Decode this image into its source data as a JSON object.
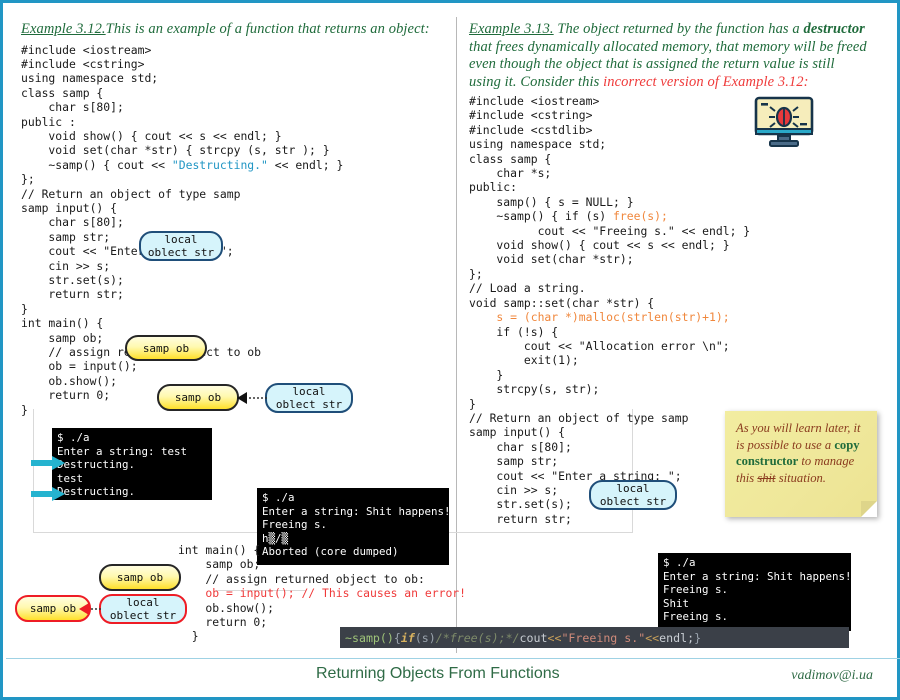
{
  "slide": {
    "accent_border": "#2196c4",
    "footer_title": "Returning Objects From Functions",
    "footer_email": "vadimov@i.ua"
  },
  "left": {
    "heading_label": "Example 3.12.",
    "heading_text": "This  is an example of a function that returns an object:",
    "code": [
      "#include <iostream>",
      "#include <cstring>",
      "using namespace std;",
      "class samp {",
      "    char s[80];",
      "public :",
      "    void show() { cout << s << endl; }",
      "    void set(char *str) { strcpy (s, str ); }",
      "    ~samp() { cout << \"Destructing.\" << endl; }",
      "};",
      "// Return an object of type samp",
      "samp input() {",
      "    char s[80];",
      "    samp str;",
      "    cout << \"Enter a string: \";",
      "    cin >> s;",
      "    str.set(s);",
      "    return str;",
      "}",
      "int main() {",
      "    samp ob;",
      "    // assign returned object to ob",
      "    ob = input();",
      "    ob.show();",
      "    return 0;",
      "}"
    ],
    "string_literals": [
      "\"Destructing.\""
    ]
  },
  "right": {
    "heading_label": "Example 3.13.",
    "heading_text_1": " The object returned by the function has a ",
    "heading_bold": "destructor",
    "heading_text_2": " that frees dynamically allocated memory, that memory will be freed even though the object that is assigned the return value is still using it. Consider this ",
    "heading_red_1": "incorrect version of",
    "heading_red_2": "Example 3.12",
    "heading_tail": ":",
    "code": [
      "#include <iostream>",
      "#include <cstring>",
      "#include <cstdlib>",
      "using namespace std;",
      "class samp {",
      "    char *s;",
      "public:",
      "    samp() { s = NULL; }",
      "    ~samp() { if (s) free(s);",
      "          cout << \"Freeing s.\" << endl; }",
      "    void show() { cout << s << endl; }",
      "    void set(char *str);",
      "};",
      "// Load a string.",
      "void samp::set(char *str) {",
      "    s = (char *)malloc(strlen(str)+1);",
      "    if (!s) {",
      "        cout << \"Allocation error \\n\";",
      "        exit(1);",
      "    }",
      "    strcpy(s, str);",
      "}",
      "// Return an object of type samp",
      "samp input() {",
      "    char s[80];",
      "    samp str;",
      "    cout << \"Enter a string: \";",
      "    cin >> s;",
      "    str.set(s);",
      "    return str;",
      "}"
    ]
  },
  "bottom_main": {
    "code": [
      "int main() {",
      "    samp ob;",
      "    // assign returned object to ob:",
      "    ob = input(); // This causes an error!",
      "    ob.show();",
      "    return 0;",
      "  }"
    ],
    "error_line": "    ob = input(); // This causes an error!"
  },
  "terminals": {
    "term1": [
      "$ ./a",
      "Enter a string: test",
      "Destructing.",
      "test",
      "Destructing."
    ],
    "term2": [
      "$ ./a",
      "Enter a string: Shit happens!",
      "Freeing s.",
      "h▒/▒",
      "Aborted (core dumped)"
    ],
    "term3": [
      "$ ./a",
      "Enter a string: Shit happens!",
      "Freeing s.",
      "Shit",
      "Freeing s."
    ]
  },
  "bubbles": {
    "local_obj_1": "local\noblect str",
    "samp_ob_1": "samp ob",
    "samp_ob_2": "samp ob",
    "local_obj_2": "local\noblect str",
    "local_obj_3": "local\noblect str",
    "samp_ob_3": "samp ob",
    "local_obj_4": "local\noblect str"
  },
  "sticky": {
    "line1": "As you will learn later,",
    "line2": "it is possible to use a",
    "bold": "copy constructor",
    "after_bold": " to",
    "line4_pre": "manage this ",
    "line4_strike": "shit",
    "line5": "situation."
  },
  "dark_bar": {
    "fn": "~samp()",
    "brace_open": " { ",
    "kw_if": "if",
    "cond": " (s) ",
    "comment": "/*free(s);*/",
    "cout": " cout ",
    "op1": "<< ",
    "string": "\"Freeing s.\"",
    "op2": " << ",
    "endl": "endl;",
    "brace_close": " }"
  },
  "colors": {
    "accent": "#2196c4",
    "green_text": "#1f6b3b",
    "red_text": "#ef3a3a",
    "orange_code": "#f0873c",
    "string_blue": "#2196c4",
    "sticky_bg": "#efe79a",
    "bubble_cyan": "#d6f4fb",
    "bubble_yellow": "#ffe02a",
    "arrow_cyan": "#25b3cf"
  }
}
